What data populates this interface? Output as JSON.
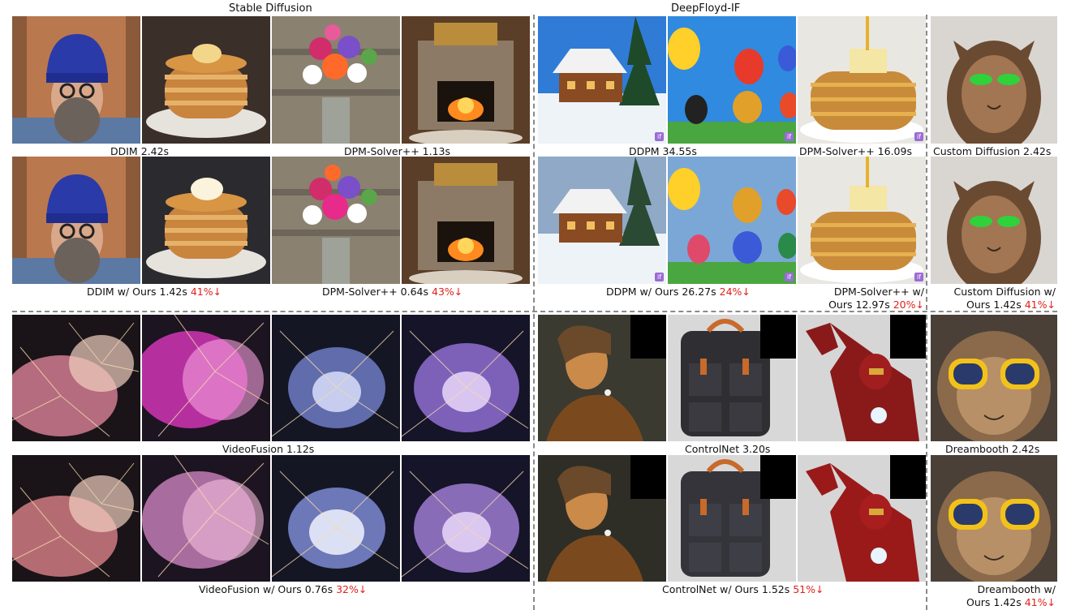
{
  "headers": {
    "stable_diffusion": "Stable Diffusion",
    "deepfloyd_if": "DeepFloyd-IF"
  },
  "captions": {
    "ddim": "DDIM 2.42s",
    "dpm_solver_sd": "DPM-Solver++ 1.13s",
    "ddpm": "DDPM 34.55s",
    "dpm_solver_if": "DPM-Solver++ 16.09s",
    "custom_diffusion": "Custom Diffusion 2.42s",
    "ddim_ours": "DDIM w/ Ours 1.42s",
    "ddim_ours_pct": "41%↓",
    "dpm_solver_sd_ours": "DPM-Solver++ 0.64s",
    "dpm_solver_sd_ours_pct": "43%↓",
    "ddpm_ours": "DDPM w/ Ours 26.27s",
    "ddpm_ours_pct": "24%↓",
    "dpm_solver_if_ours_l1": "DPM-Solver++ w/",
    "dpm_solver_if_ours_l2": "Ours 12.97s",
    "dpm_solver_if_ours_pct": "20%↓",
    "custom_diffusion_ours_l1": "Custom Diffusion w/",
    "custom_diffusion_ours_l2": "Ours 1.42s",
    "custom_diffusion_ours_pct": "41%↓",
    "videofusion": "VideoFusion 1.12s",
    "controlnet": "ControlNet 3.20s",
    "dreambooth": "Dreambooth 2.42s",
    "videofusion_ours": "VideoFusion w/ Ours 0.76s",
    "videofusion_ours_pct": "32%↓",
    "controlnet_ours": "ControlNet w/ Ours 1.52s",
    "controlnet_ours_pct": "51%↓",
    "dreambooth_ours_l1": "Dreambooth w/",
    "dreambooth_ours_l2": "Ours 1.42s",
    "dreambooth_ours_pct": "41%↓"
  },
  "badge_text": "if",
  "colors": {
    "reduction": "#e0201b",
    "divider": "#8a8a8a"
  },
  "images": [
    "bearded-man-beanie",
    "pancake-stack",
    "flower-bouquet",
    "stone-fireplace",
    "snow-cabin",
    "hot-air-balloons",
    "pancakes-syrup",
    "cat-sunglasses-green",
    "fireworks",
    "girl-pearl-earring-painting",
    "backpack",
    "iron-man",
    "cat-sunglasses-yellow"
  ]
}
